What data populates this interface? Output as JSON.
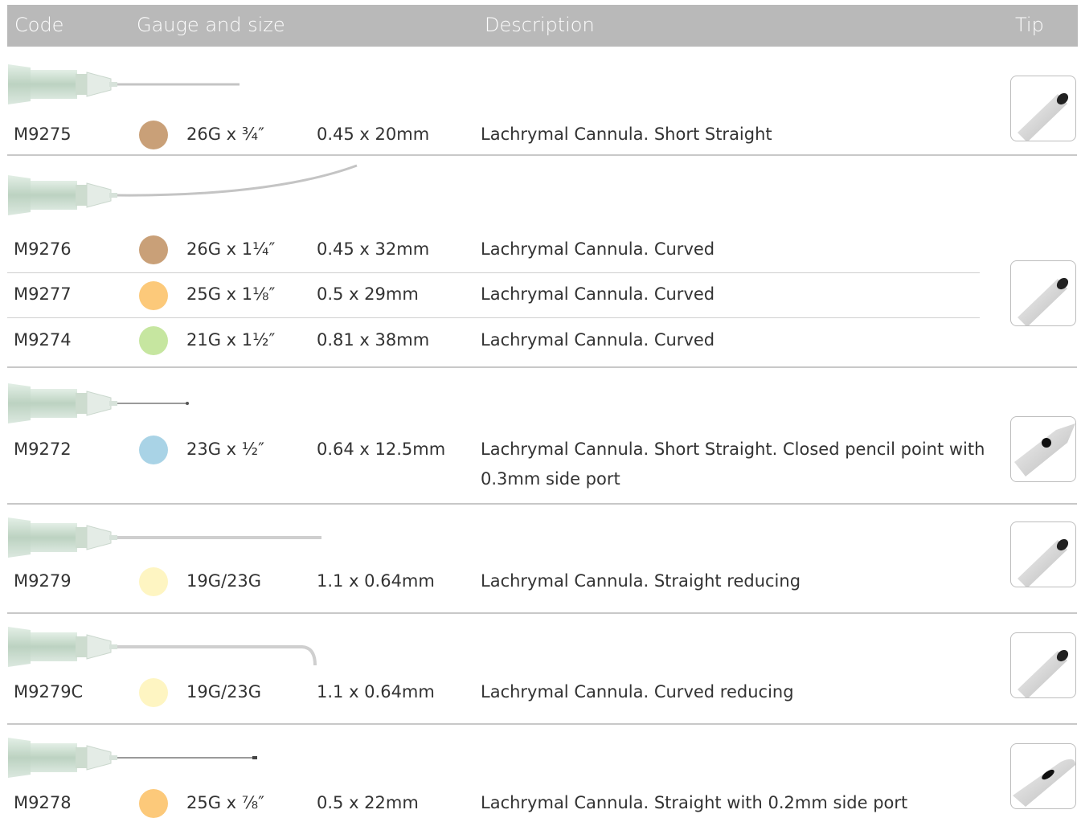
{
  "header": {
    "code": "Code",
    "gauge": "Gauge and size",
    "description": "Description",
    "tip": "Tip"
  },
  "colors": {
    "header_bg": "#b9b9b9",
    "brown": "#c9a078",
    "orange": "#fcc97a",
    "green": "#c6e6a0",
    "blue": "#a9d3e6",
    "yellow": "#fef5c2"
  },
  "products": [
    {
      "code": "M9275",
      "gauge": "26G x ¾″",
      "size": "0.45 x 20mm",
      "description": "Lachrymal Cannula. Short Straight",
      "hub_color": "#c9a078"
    },
    {
      "code": "M9276",
      "gauge": "26G x 1¼″",
      "size": "0.45 x 32mm",
      "description": "Lachrymal Cannula. Curved",
      "hub_color": "#c9a078"
    },
    {
      "code": "M9277",
      "gauge": "25G x 1⅛″",
      "size": "0.5 x 29mm",
      "description": "Lachrymal Cannula. Curved",
      "hub_color": "#fcc97a"
    },
    {
      "code": "M9274",
      "gauge": "21G x 1½″",
      "size": "0.81 x 38mm",
      "description": "Lachrymal Cannula. Curved",
      "hub_color": "#c6e6a0"
    },
    {
      "code": "M9272",
      "gauge": "23G x ½″",
      "size": "0.64 x 12.5mm",
      "description": "Lachrymal Cannula. Short Straight. Closed pencil point with",
      "description_line2": "0.3mm side port",
      "hub_color": "#a9d3e6"
    },
    {
      "code": "M9279",
      "gauge": "19G/23G",
      "size": "1.1 x 0.64mm",
      "description": "Lachrymal Cannula. Straight reducing",
      "hub_color": "#fef5c2"
    },
    {
      "code": "M9279C",
      "gauge": "19G/23G",
      "size": "1.1 x 0.64mm",
      "description": "Lachrymal Cannula. Curved reducing",
      "hub_color": "#fef5c2"
    },
    {
      "code": "M9278",
      "gauge": "25G x ⅞″",
      "size": "0.5 x 22mm",
      "description": "Lachrymal Cannula. Straight with 0.2mm side port",
      "hub_color": "#fcc97a"
    }
  ],
  "icons": {
    "needle": "cannula-illustration-icon",
    "tip_open": "open-tip-icon",
    "tip_pencil": "pencil-point-tip-icon",
    "tip_side_port": "side-port-tip-icon"
  }
}
